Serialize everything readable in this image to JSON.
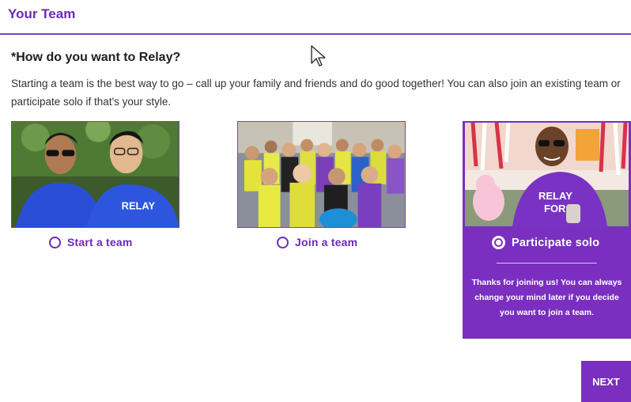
{
  "header": {
    "title": "Your Team"
  },
  "question": "*How do you want to Relay?",
  "description": "Starting a team is the best way to go – call up your family and friends and do good together! You can also join an existing team or participate solo if that's your style.",
  "options": [
    {
      "label": "Start a team",
      "selected": false
    },
    {
      "label": "Join a team",
      "selected": false
    },
    {
      "label": "Participate solo",
      "selected": true
    }
  ],
  "solo_note": "Thanks for joining us! You can always change your mind later if you decide you want to join a team.",
  "next_label": "NEXT",
  "shirt_text": {
    "line1": "RELAY",
    "line2": "FOR"
  },
  "colors": {
    "brand_purple": "#7a2fc0",
    "heading_purple": "#6b2bb5",
    "shirt_blue": "#2a4fd6"
  }
}
